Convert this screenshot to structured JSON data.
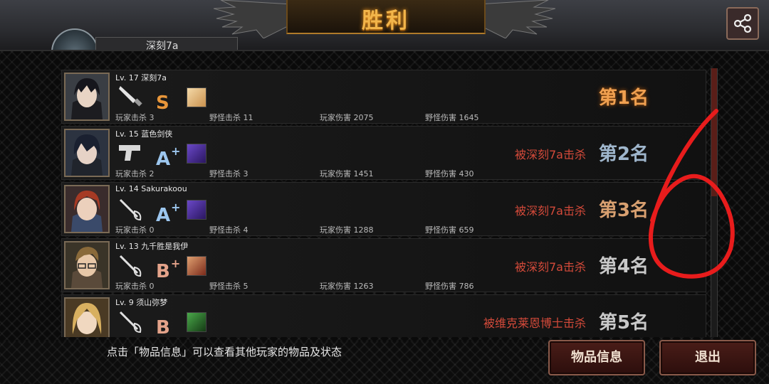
{
  "top": {
    "title": "胜利",
    "left_name": "深刻7a"
  },
  "colors": {
    "title": "#f2b54a",
    "kill": "#d44a3a",
    "rank1": "#f0a050",
    "rank": "#9fb6cc",
    "grade_s": "#e8963a",
    "grade_a": "#9cc6ee",
    "grade_b": "#e4a38a"
  },
  "players": [
    {
      "level": "Lv. 17",
      "name": "深刻7a",
      "weapon": "knife-icon",
      "grade": "S",
      "grade_sup": "",
      "item": "hand-item-icon",
      "player_kills_label": "玩家击杀",
      "player_kills": "3",
      "monster_kills_label": "野怪击杀",
      "monster_kills": "11",
      "player_damage_label": "玩家伤害",
      "player_damage": "2075",
      "monster_damage_label": "野怪伤害",
      "monster_damage": "1645",
      "killed_by": "",
      "rank": "第1名"
    },
    {
      "level": "Lv. 15",
      "name": "蓝色剑侠",
      "weapon": "pistol-icon",
      "grade": "A",
      "grade_sup": "+",
      "item": "purple-item-icon",
      "player_kills_label": "玩家击杀",
      "player_kills": "2",
      "monster_kills_label": "野怪击杀",
      "monster_kills": "3",
      "player_damage_label": "玩家伤害",
      "player_damage": "1451",
      "monster_damage_label": "野怪伤害",
      "monster_damage": "430",
      "killed_by": "被深刻7a击杀",
      "rank": "第2名"
    },
    {
      "level": "Lv. 14",
      "name": "Sakurakoou",
      "weapon": "rapier-icon",
      "grade": "A",
      "grade_sup": "+",
      "item": "purple-item-icon",
      "player_kills_label": "玩家击杀",
      "player_kills": "0",
      "monster_kills_label": "野怪击杀",
      "monster_kills": "4",
      "player_damage_label": "玩家伤害",
      "player_damage": "1288",
      "monster_damage_label": "野怪伤害",
      "monster_damage": "659",
      "killed_by": "被深刻7a击杀",
      "rank": "第3名"
    },
    {
      "level": "Lv. 13",
      "name": "九千胜是我伊",
      "weapon": "rapier-icon",
      "grade": "B",
      "grade_sup": "+",
      "item": "face-item-icon",
      "player_kills_label": "玩家击杀",
      "player_kills": "0",
      "monster_kills_label": "野怪击杀",
      "monster_kills": "5",
      "player_damage_label": "玩家伤害",
      "player_damage": "1263",
      "monster_damage_label": "野怪伤害",
      "monster_damage": "786",
      "killed_by": "被深刻7a击杀",
      "rank": "第4名"
    },
    {
      "level": "Lv. 9",
      "name": "须山弥梦",
      "weapon": "rapier-icon",
      "grade": "B",
      "grade_sup": "",
      "item": "green-item-icon",
      "player_kills_label": "",
      "player_kills": "",
      "monster_kills_label": "",
      "monster_kills": "",
      "player_damage_label": "",
      "player_damage": "",
      "monster_damage_label": "",
      "monster_damage": "",
      "killed_by": "被维克莱恩博士击杀",
      "rank": "第5名"
    }
  ],
  "footer": {
    "hint": "点击「物品信息」可以查看其他玩家的物品及状态",
    "items_button": "物品信息",
    "exit_button": "退出"
  },
  "annotation_text": "6"
}
